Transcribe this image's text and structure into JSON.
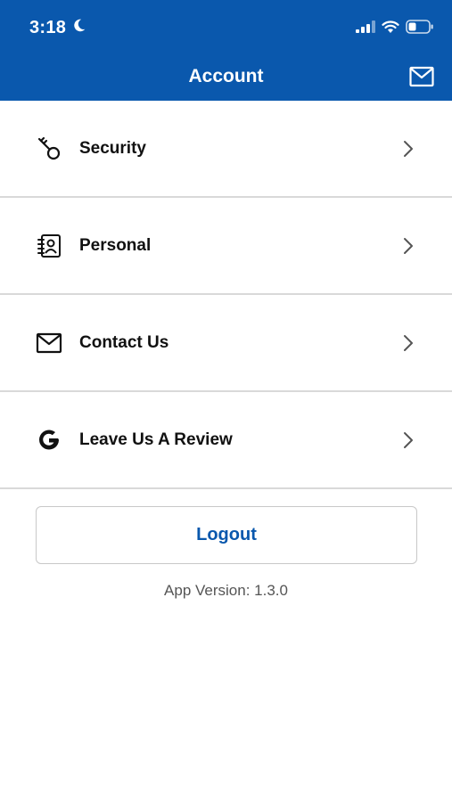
{
  "status_bar": {
    "time": "3:18"
  },
  "header": {
    "title": "Account"
  },
  "menu": {
    "items": [
      {
        "label": "Security",
        "icon": "key-icon"
      },
      {
        "label": "Personal",
        "icon": "contact-card-icon"
      },
      {
        "label": "Contact Us",
        "icon": "envelope-icon"
      },
      {
        "label": "Leave Us A Review",
        "icon": "google-icon"
      }
    ]
  },
  "logout": {
    "label": "Logout"
  },
  "footer": {
    "app_version": "App Version: 1.3.0"
  },
  "colors": {
    "brand_blue": "#0a58ad",
    "divider": "#d9d9d9"
  }
}
